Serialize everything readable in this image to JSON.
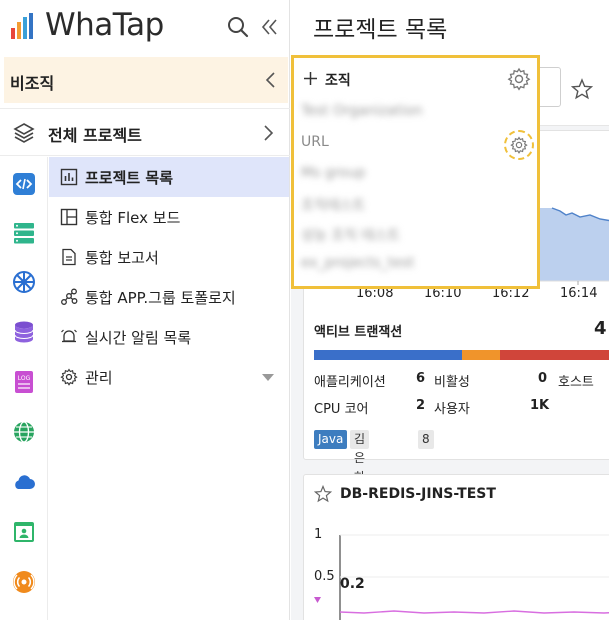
{
  "brand": {
    "name": "WhaTap"
  },
  "sidebar": {
    "org_label": "비조직",
    "all_projects_label": "전체 프로젝트",
    "menu": [
      {
        "label": "프로젝트 목록",
        "icon": "chart-list-icon",
        "active": true
      },
      {
        "label": "통합 Flex 보드",
        "icon": "layout-board-icon",
        "active": false
      },
      {
        "label": "통합 보고서",
        "icon": "document-icon",
        "active": false
      },
      {
        "label": "통합 APP.그룹 토폴로지",
        "icon": "topology-icon",
        "active": false
      },
      {
        "label": "실시간 알림 목록",
        "icon": "alarm-icon",
        "active": false
      },
      {
        "label": "관리",
        "icon": "gear-icon",
        "active": false
      }
    ],
    "rail_icons": [
      "code-icon",
      "server-icon",
      "kubernetes-icon",
      "database-icon",
      "log-icon",
      "globe-icon",
      "cloud-icon",
      "browser-icon",
      "signal-icon"
    ]
  },
  "main": {
    "title": "프로젝트 목록",
    "card1": {
      "x_ticks": [
        "16:08",
        "16:10",
        "16:12",
        "16:14"
      ],
      "active_tx_title": "액티브 트랜잭션",
      "active_tx_count": "4",
      "stats": {
        "app_label": "애플리케이션",
        "app_value": "6",
        "inactive_label": "비활성",
        "inactive_value": "0",
        "host_label": "호스트",
        "cpu_label": "CPU 코어",
        "cpu_value": "2",
        "user_label": "사용자",
        "user_value": "1K"
      },
      "tags": {
        "lang": "Java",
        "group": "김은하그룹",
        "count": "8"
      }
    },
    "card2": {
      "title": "DB-REDIS-JINS-TEST",
      "y_ticks": [
        "1",
        "0.5"
      ],
      "value_label": "0.2"
    }
  },
  "popover": {
    "add_label": "조직",
    "items": [
      {
        "text": "Test Organization",
        "blurred": true
      },
      {
        "text": "URL",
        "blurred": false
      },
      {
        "text": "Ms group",
        "blurred": true
      },
      {
        "text": "조직테스트",
        "blurred": true
      },
      {
        "text": "성능 조직 테스트",
        "blurred": true
      },
      {
        "text": "ex_projects_test",
        "blurred": true
      }
    ]
  },
  "colors": {
    "accent": "#f0c03a",
    "active_menu_bg": "#dfe5fa",
    "org_bar_bg": "#fdf3e3",
    "tx_blue": "#3a6fc9",
    "tx_orange": "#f0942b",
    "tx_red": "#d0453a",
    "tag_java": "#3d7dbf",
    "chart_line": "#4f82c9",
    "chart2_line": "#d86ee0"
  }
}
